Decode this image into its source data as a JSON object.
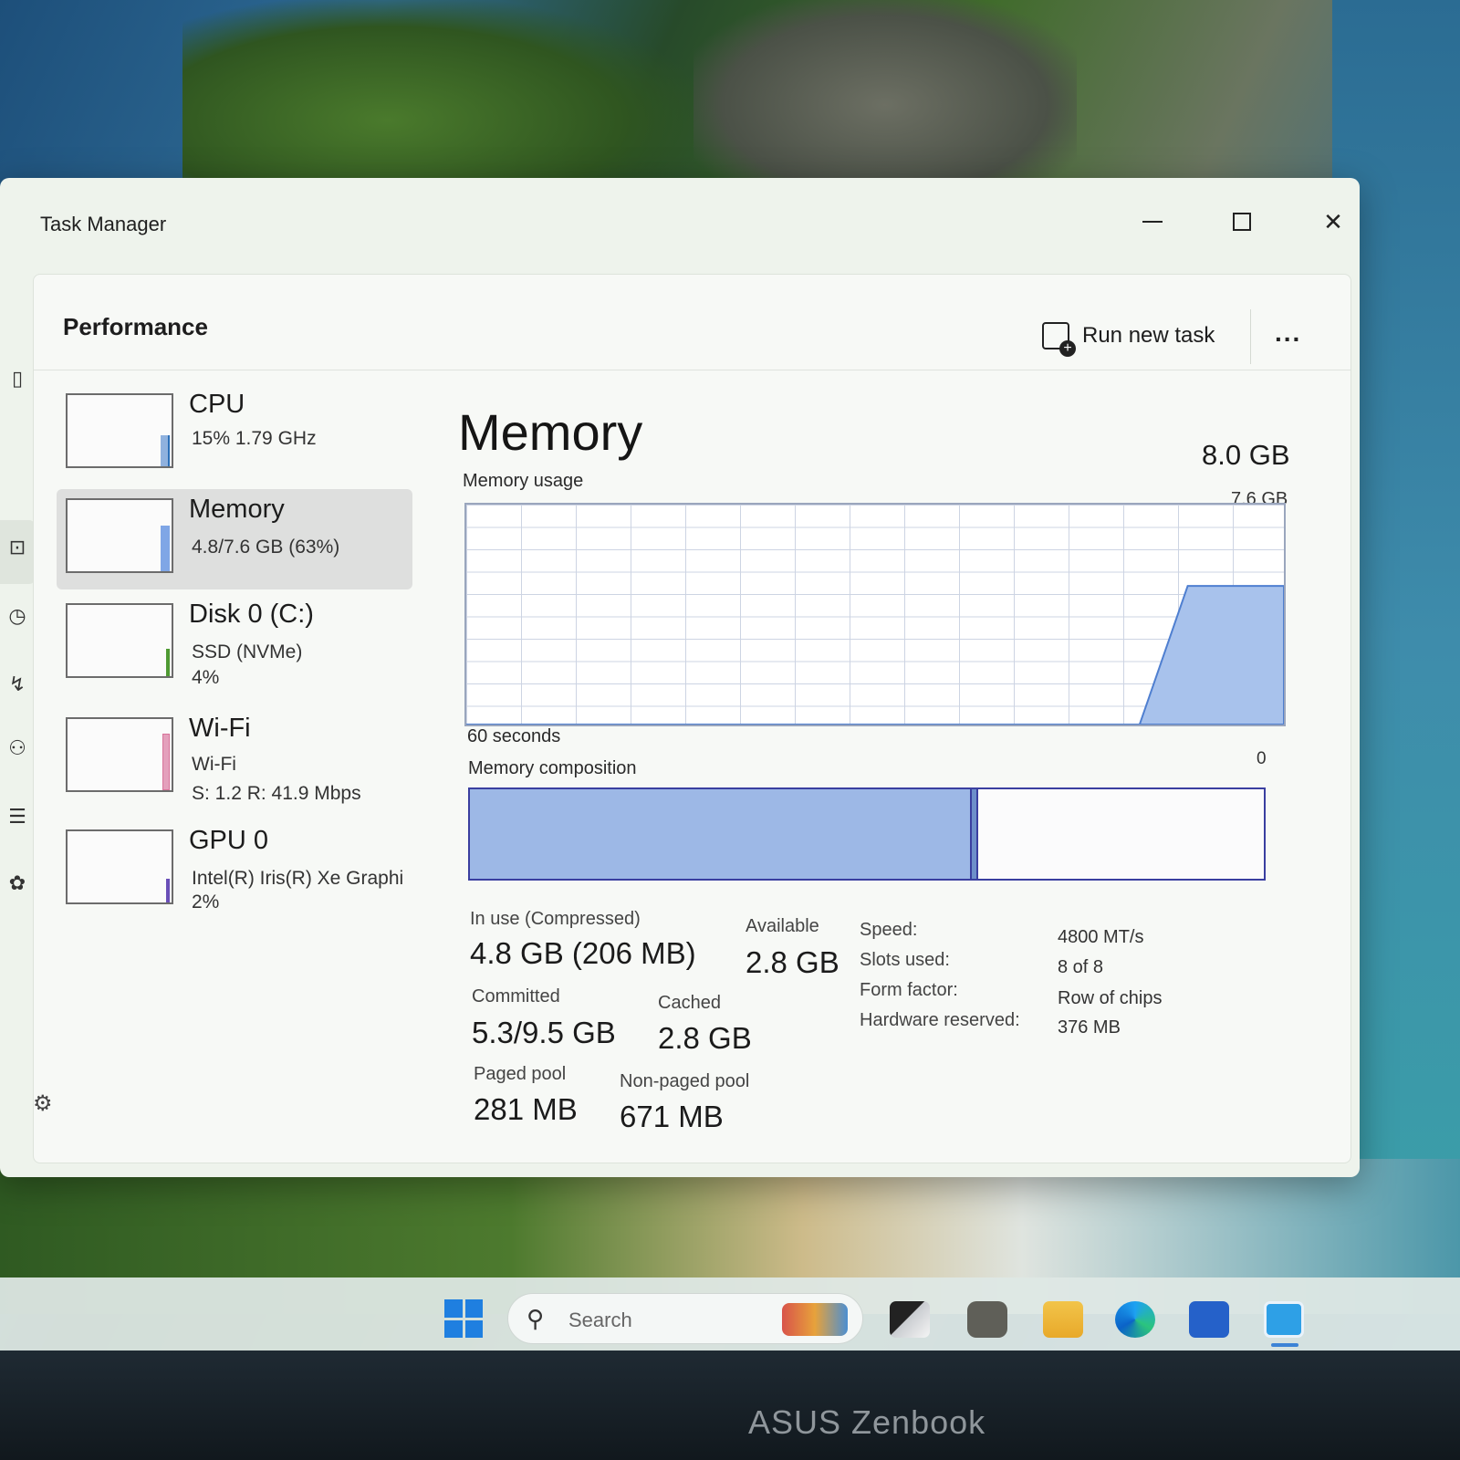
{
  "window": {
    "title": "Task Manager"
  },
  "header": {
    "page_title": "Performance",
    "run_new_task_label": "Run new task",
    "more_label": "..."
  },
  "devices": [
    {
      "name": "CPU",
      "line1": "15%  1.79 GHz",
      "line2": "",
      "color": "#2b6fb8",
      "selected": false
    },
    {
      "name": "Memory",
      "line1": "4.8/7.6 GB (63%)",
      "line2": "",
      "color": "#7fa6e6",
      "selected": true
    },
    {
      "name": "Disk 0 (C:)",
      "line1": "SSD (NVMe)",
      "line2": "4%",
      "color": "#4f9a33",
      "selected": false
    },
    {
      "name": "Wi-Fi",
      "line1": "Wi-Fi",
      "line2": "S: 1.2  R: 41.9 Mbps",
      "color": "#d8739a",
      "selected": false
    },
    {
      "name": "GPU 0",
      "line1": "Intel(R) Iris(R) Xe Graphi",
      "line2": "2%",
      "color": "#6a4fb8",
      "selected": false
    }
  ],
  "memory": {
    "title": "Memory",
    "total": "8.0 GB",
    "usage_label": "Memory usage",
    "usage_max": "7.6 GB",
    "seconds_label": "60 seconds",
    "zero_label": "0",
    "composition_label": "Memory composition",
    "usage_series": [
      0,
      0,
      0,
      0,
      0,
      0,
      0,
      0,
      0,
      0,
      0,
      0,
      0,
      0,
      0,
      0.63,
      0.63,
      0.63
    ],
    "composition": {
      "in_use_fraction": 0.63,
      "modified_fraction": 0.01,
      "colors": {
        "in_use": "#9db8e6",
        "modified": "#6d8fca",
        "border": "#3a3fa0"
      }
    },
    "stats": {
      "in_use_label": "In use (Compressed)",
      "in_use_value": "4.8 GB (206 MB)",
      "available_label": "Available",
      "available_value": "2.8 GB",
      "committed_label": "Committed",
      "committed_value": "5.3/9.5 GB",
      "cached_label": "Cached",
      "cached_value": "2.8 GB",
      "paged_label": "Paged pool",
      "paged_value": "281 MB",
      "nonpaged_label": "Non-paged pool",
      "nonpaged_value": "671 MB"
    },
    "specs": [
      {
        "key": "Speed:",
        "value": "4800 MT/s"
      },
      {
        "key": "Slots used:",
        "value": "8 of 8"
      },
      {
        "key": "Form factor:",
        "value": "Row of chips"
      },
      {
        "key": "Hardware reserved:",
        "value": "376 MB"
      }
    ]
  },
  "taskbar": {
    "search_placeholder": "Search",
    "icons": [
      "windows-start-icon",
      "search-icon",
      "task-view-icon",
      "widgets-icon",
      "file-explorer-icon",
      "edge-icon",
      "store-icon",
      "task-manager-icon"
    ]
  },
  "bezel": {
    "brand": "ASUS Zenbook"
  }
}
